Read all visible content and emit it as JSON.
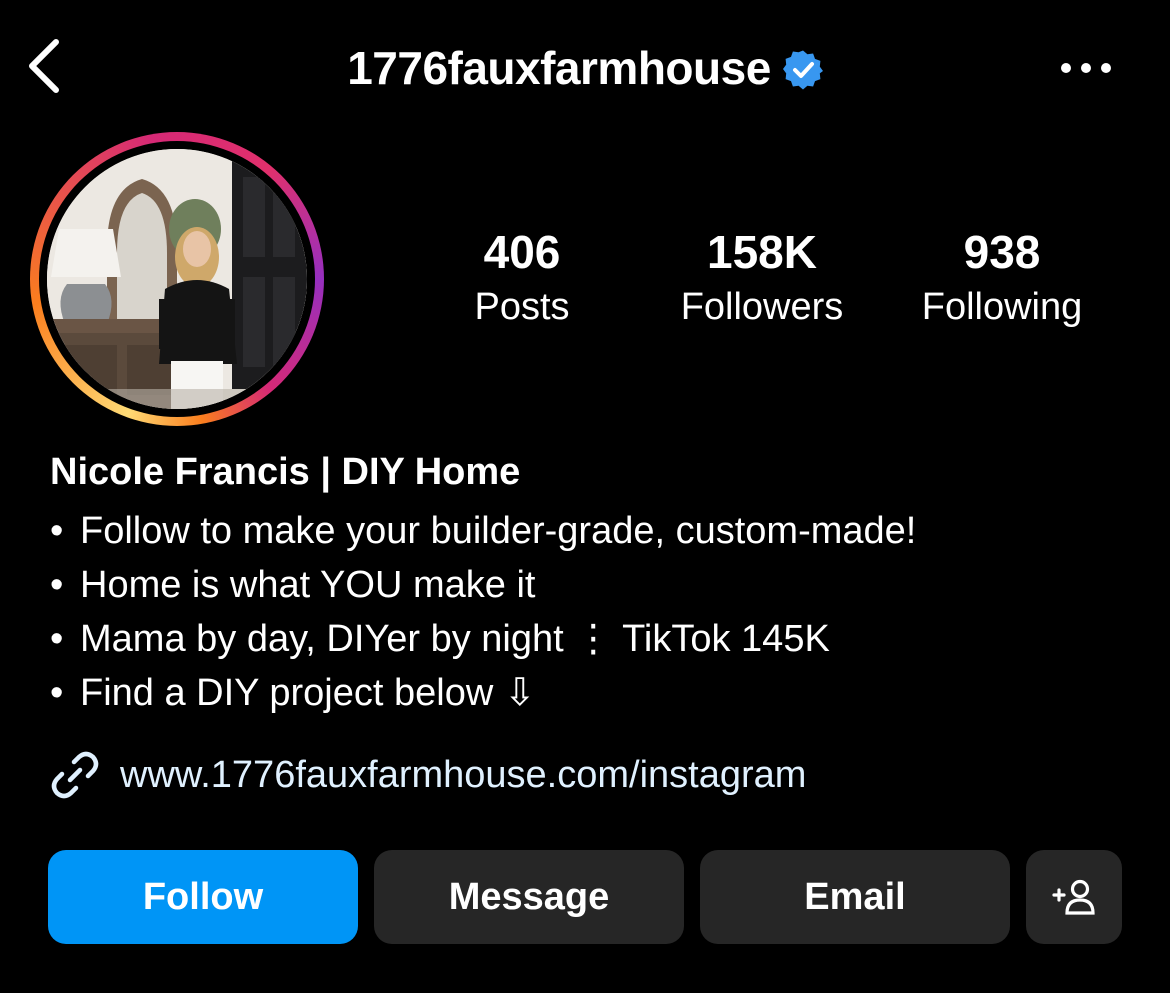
{
  "header": {
    "username": "1776fauxfarmhouse",
    "verified": true,
    "back_icon": "chevron-left-icon",
    "more_icon": "more-horizontal-icon"
  },
  "profile": {
    "avatar_alt": "profile picture",
    "stats": [
      {
        "value": "406",
        "label": "Posts"
      },
      {
        "value": "158K",
        "label": "Followers"
      },
      {
        "value": "938",
        "label": "Following"
      }
    ],
    "display_name": "Nicole Francis | DIY Home",
    "bio_lines": [
      {
        "bullet": "•",
        "text": "Follow to make your builder-grade, custom-made!"
      },
      {
        "bullet": "•",
        "text": "Home is what YOU make it"
      },
      {
        "bullet": "•",
        "text": "Mama by day, DIYer by night ⋮ TikTok 145K"
      },
      {
        "bullet": "•",
        "text": "Find a DIY project below ⇩"
      }
    ],
    "link": {
      "icon": "link-icon",
      "text": "www.1776fauxfarmhouse.com/instagram"
    }
  },
  "actions": {
    "follow_label": "Follow",
    "message_label": "Message",
    "email_label": "Email",
    "add_icon": "add-person-icon"
  },
  "colors": {
    "background": "#000000",
    "follow_button": "#0095f6",
    "secondary_button": "#262626",
    "verified_badge": "#3897f0",
    "link_text": "#e0f1ff"
  }
}
